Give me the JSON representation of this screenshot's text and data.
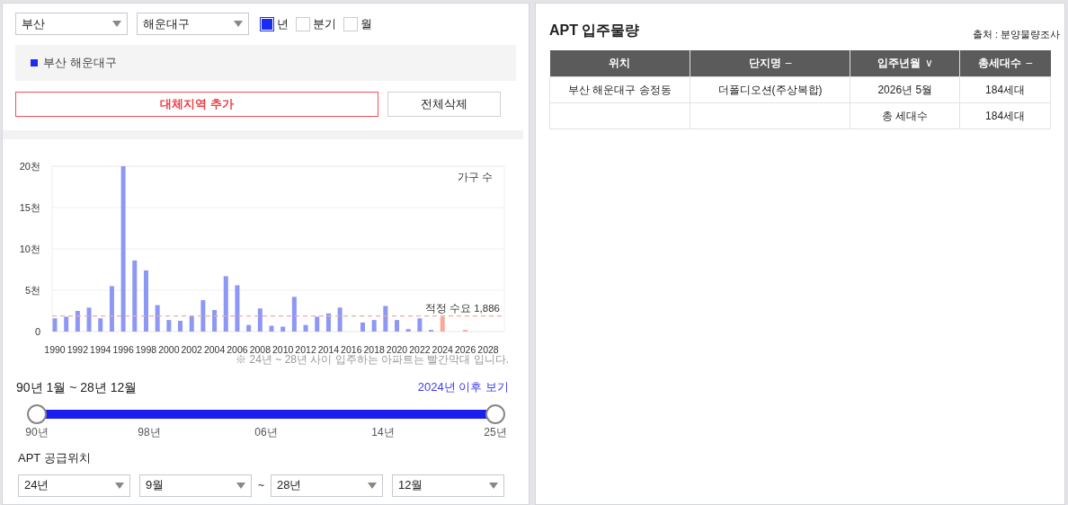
{
  "filters": {
    "region": "부산",
    "district": "해운대구",
    "periods": [
      {
        "label": "년",
        "checked": true
      },
      {
        "label": "분기",
        "checked": false
      },
      {
        "label": "월",
        "checked": false
      }
    ]
  },
  "selected_regions": [
    {
      "label": "부산 해운대구",
      "color": "#1a2cf0"
    }
  ],
  "buttons": {
    "add": "대체지역 추가",
    "clear": "전체삭제"
  },
  "chart": {
    "chart_data": {
      "type": "bar",
      "ylabel": "가구 수",
      "categories": [
        "1990",
        null,
        "1992",
        null,
        "1994",
        null,
        "1996",
        null,
        "1998",
        null,
        "2000",
        null,
        "2002",
        null,
        "2004",
        null,
        "2006",
        null,
        "2008",
        null,
        "2010",
        null,
        "2012",
        null,
        "2014",
        null,
        "2016",
        null,
        "2018",
        null,
        "2020",
        null,
        "2022",
        null,
        "2024",
        null,
        "2026",
        null,
        "2028"
      ],
      "series": [
        {
          "color": "#8d97f4",
          "values": [
            1.6,
            1.8,
            2.5,
            2.9,
            1.6,
            5.5,
            20,
            8.6,
            7.4,
            3.2,
            1.4,
            1.3,
            1.9,
            3.8,
            2.6,
            6.7,
            5.6,
            0.8,
            2.8,
            0.7,
            0.6,
            4.2,
            0.8,
            1.8,
            2.2,
            2.9,
            null,
            1.1,
            1.4,
            3.1,
            1.4,
            0.3,
            1.6,
            0.2,
            null,
            null,
            null,
            null,
            null
          ]
        },
        {
          "color": "#f7a99c",
          "values": [
            null,
            null,
            null,
            null,
            null,
            null,
            null,
            null,
            null,
            null,
            null,
            null,
            null,
            null,
            null,
            null,
            null,
            null,
            null,
            null,
            null,
            null,
            null,
            null,
            null,
            null,
            null,
            null,
            null,
            null,
            null,
            null,
            null,
            null,
            1.8,
            null,
            0.2,
            null,
            null
          ]
        }
      ],
      "grid": true,
      "ylim": [
        0,
        20
      ],
      "yticks": [
        0,
        {
          "value": 5,
          "label": "5천"
        },
        {
          "value": 10,
          "label": "10천"
        },
        {
          "value": 15,
          "label": "15천"
        },
        {
          "value": 20,
          "label": "20천"
        }
      ],
      "ref_lines": [
        {
          "axis": "y",
          "value": 1.886,
          "label": "적정 수요 1,886"
        }
      ]
    },
    "note": "※ 24년 ~ 28년 사이 입주하는 아파트는 빨간막대 입니다."
  },
  "range": {
    "title": "90년 1월 ~ 28년 12월",
    "link": "2024년 이후 보기",
    "level": 1,
    "ticks": [
      "90년",
      "98년",
      "06년",
      "14년",
      "25년"
    ]
  },
  "supply": {
    "title": "APT 공급위치",
    "from_year": "24년",
    "from_month": "9월",
    "separator": "~",
    "to_year": "28년",
    "to_month": "12월"
  },
  "table": {
    "title": "APT 입주물량",
    "source": "출처 : 분양물량조사",
    "columns": [
      {
        "label": "위치"
      },
      {
        "label": "단지명",
        "sort": "–"
      },
      {
        "label": "입주년월",
        "sort": "∨"
      },
      {
        "label": "총세대수",
        "sort": "–"
      }
    ],
    "rows": [
      [
        "부산 해운대구 송정동",
        "더폴디오션(주상복합)",
        "2026년 5월",
        "184세대"
      ],
      [
        "",
        "",
        "총 세대수",
        "184세대"
      ]
    ]
  }
}
